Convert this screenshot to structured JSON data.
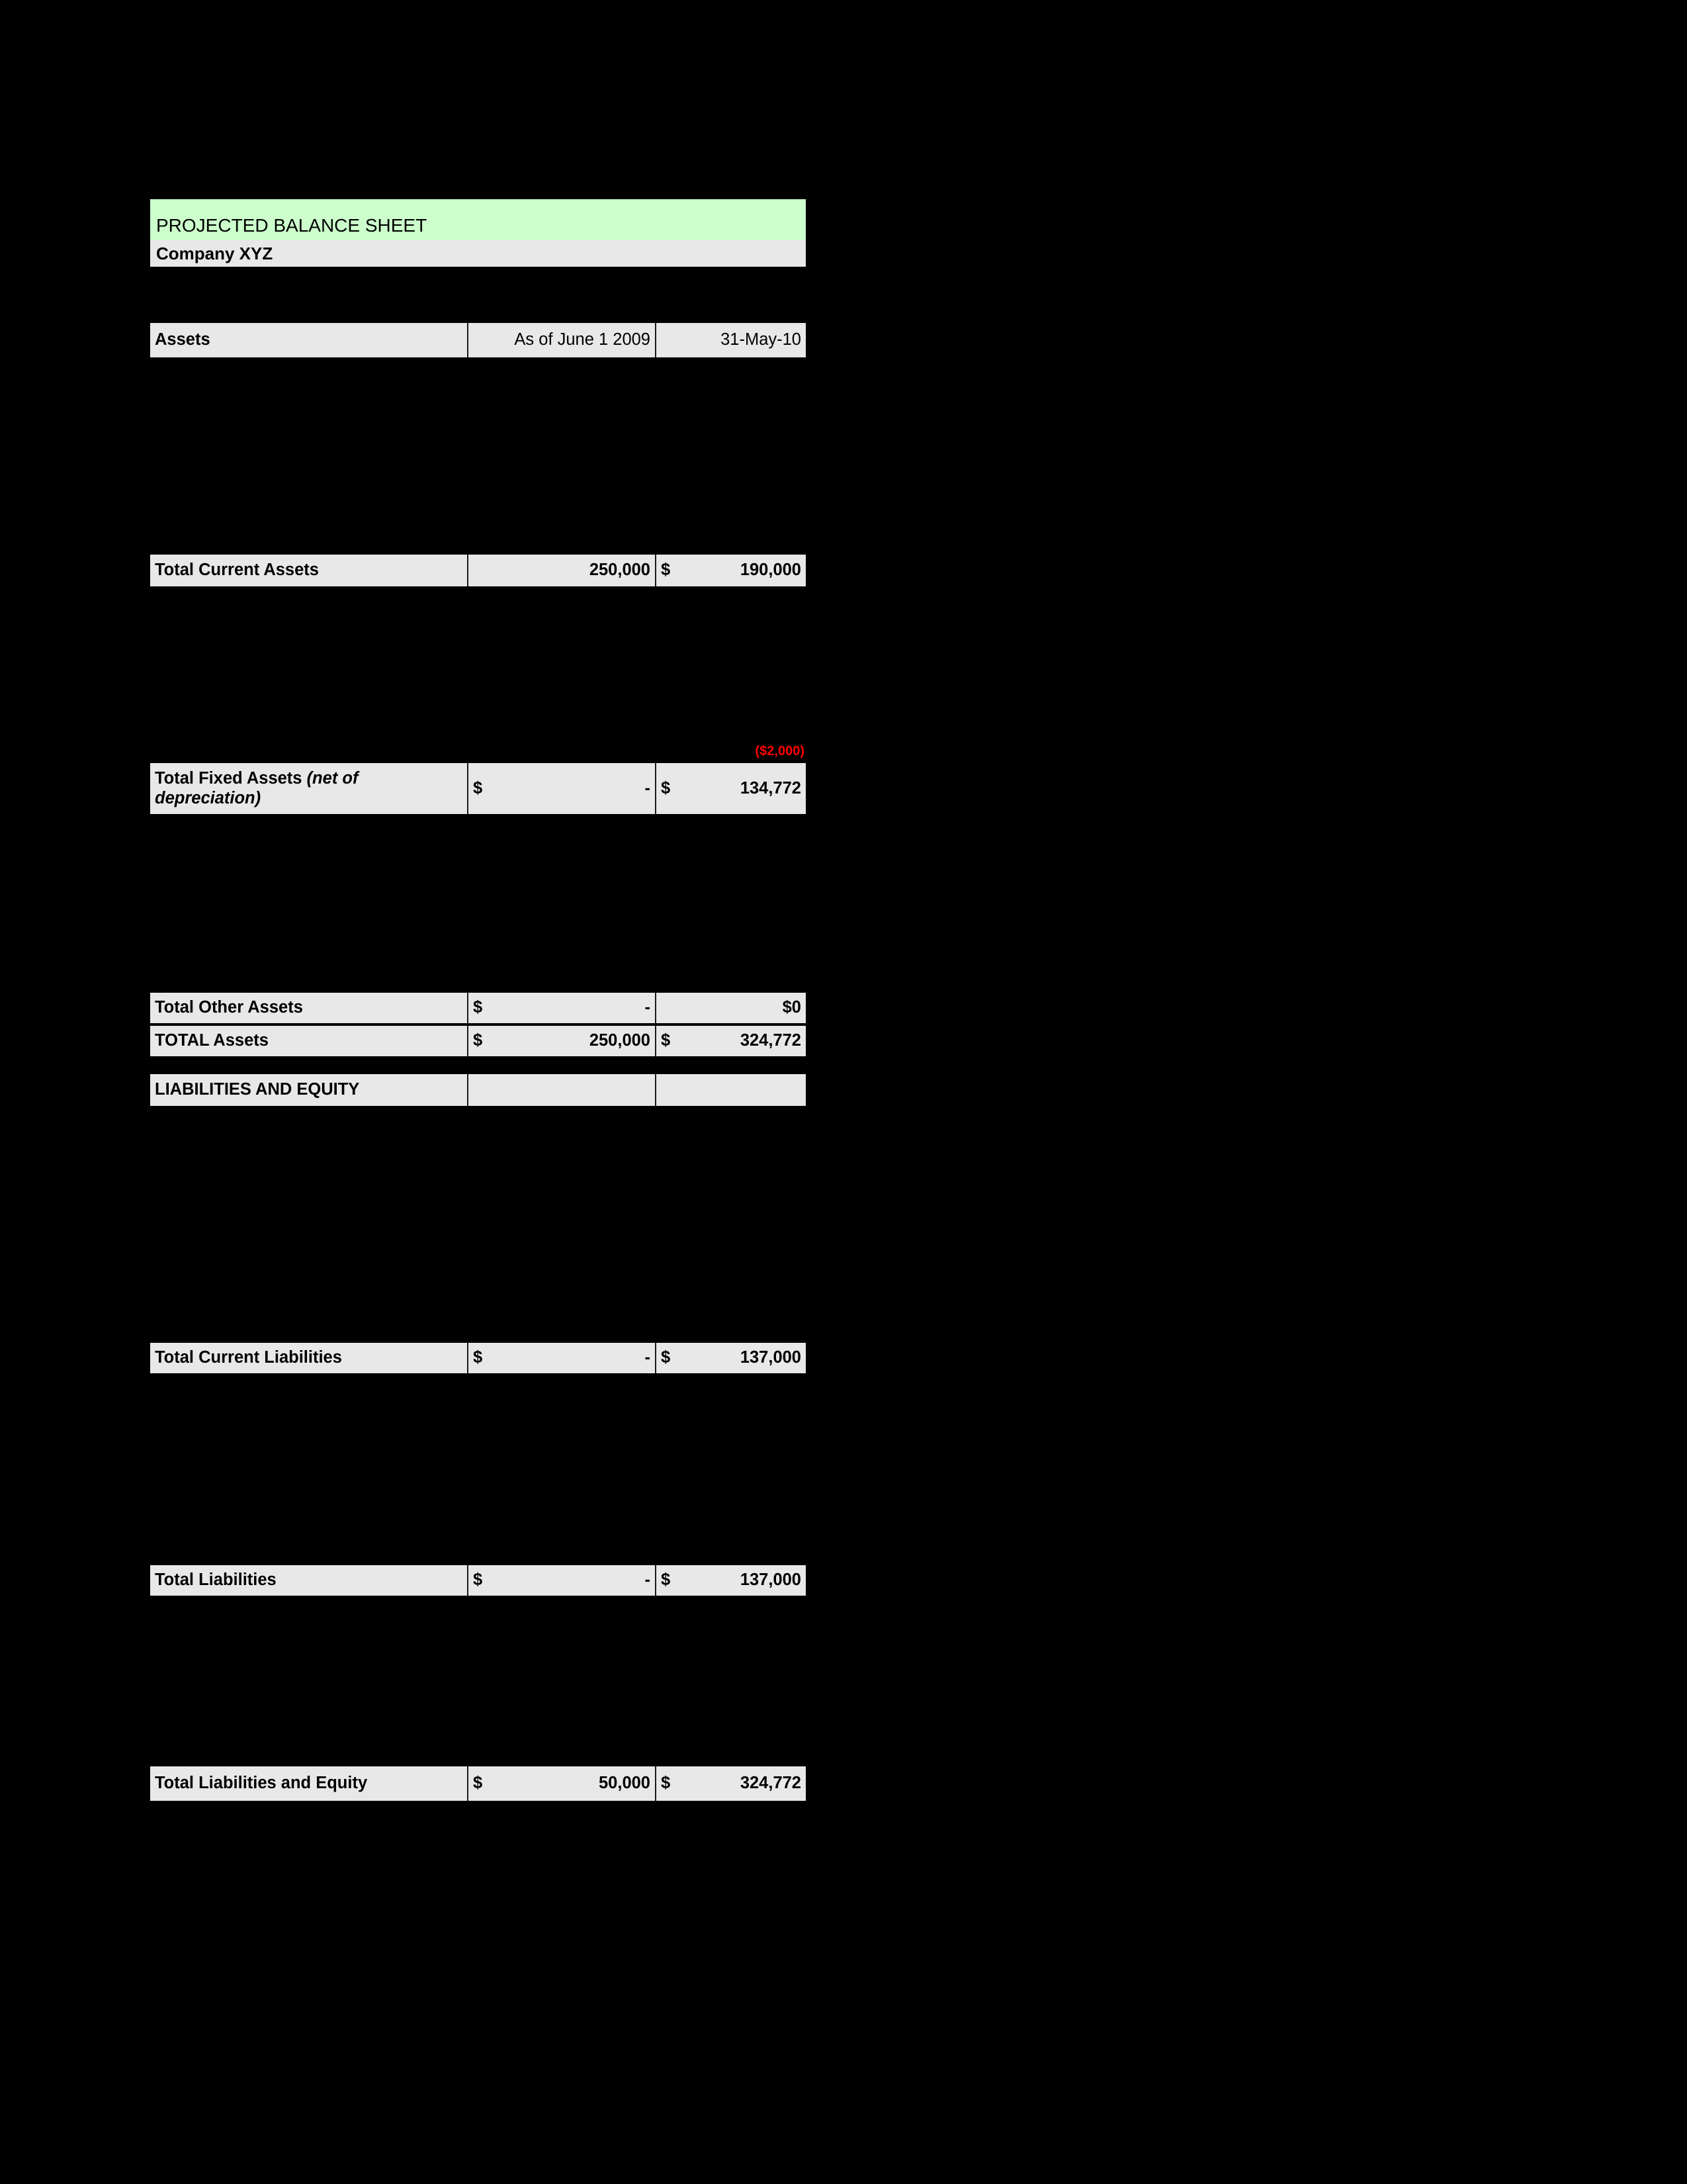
{
  "document": {
    "title": "PROJECTED BALANCE SHEET",
    "company": "Company XYZ"
  },
  "columns": {
    "label_header": "Assets",
    "period_1": "As of June 1 2009",
    "period_2": "31-May-10"
  },
  "annotations": {
    "depreciation_adjustment": "($2,000)"
  },
  "rows": {
    "total_current_assets": {
      "label": "Total Current Assets",
      "v1": "250,000",
      "v1_symbol": "",
      "v2_symbol": "$",
      "v2": "190,000"
    },
    "total_fixed_assets": {
      "label": "Total Fixed Assets ",
      "label_italic": "(net of depreciation)",
      "v1_symbol": "$",
      "v1": "-",
      "v2_symbol": "$",
      "v2": "134,772"
    },
    "total_other_assets": {
      "label": "Total Other Assets",
      "v1_symbol": "$",
      "v1": "-",
      "v2_symbol": "",
      "v2": "$0"
    },
    "total_assets": {
      "label": "TOTAL Assets",
      "v1_symbol": "$",
      "v1": "250,000",
      "v2_symbol": "$",
      "v2": "324,772"
    },
    "liabilities_and_equity": {
      "label": "LIABILITIES AND EQUITY",
      "v1": "",
      "v2": ""
    },
    "total_current_liabilities": {
      "label": "Total Current Liabilities",
      "v1_symbol": "$",
      "v1": "-",
      "v2_symbol": "$",
      "v2": "137,000"
    },
    "total_liabilities": {
      "label": "Total Liabilities",
      "v1_symbol": "$",
      "v1": "-",
      "v2_symbol": "$",
      "v2": "137,000"
    },
    "total_liabilities_and_equity": {
      "label": "Total Liabilities and Equity",
      "v1_symbol": "$",
      "v1": "50,000",
      "v2_symbol": "$",
      "v2": "324,772"
    }
  },
  "colors": {
    "title_band": "#CCFFCC",
    "cell_fill": "#E8E8E8",
    "negative_value": "#FF0000",
    "background": "#000000",
    "gridline": "#1A1A1A"
  }
}
